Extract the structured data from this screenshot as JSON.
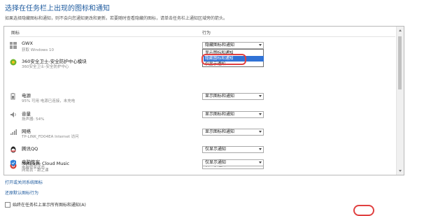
{
  "page": {
    "title": "选择在任务栏上出现的图标和通知",
    "description": "如果选择隐藏图标和通知，则不会向您通知更改和更新。若要随时查看隐藏的图标，请单击任务栏上通知区域旁的箭头。"
  },
  "table": {
    "col_icon": "图标",
    "col_behavior": "行为",
    "rows": [
      {
        "name": "GWX",
        "sub": "获取 Windows 10",
        "behavior": "隐藏图标和通知",
        "icon": "windows-logo-icon"
      },
      {
        "name": "360安全卫士-安全防护中心模块",
        "sub": "360安全卫士-安全防护中心",
        "behavior": "",
        "icon": "360-shield-icon"
      },
      {
        "name": "电源",
        "sub": "95% 可用 电源已连接，未充电",
        "behavior": "显示图标和通知",
        "icon": "power-icon"
      },
      {
        "name": "音量",
        "sub": "扬声器: 54%",
        "behavior": "显示图标和通知",
        "icon": "volume-icon"
      },
      {
        "name": "网络",
        "sub": "TP-LINK_FD04EA Internet 访问",
        "behavior": "显示图标和通知",
        "icon": "network-icon"
      },
      {
        "name": "腾讯QQ",
        "sub": "",
        "behavior": "仅显示通知",
        "icon": "qq-icon"
      },
      {
        "name": "NetEase Cloud Music",
        "sub": "网易云 - 跟之课",
        "behavior": "仅显示通知",
        "icon": "netease-music-icon"
      },
      {
        "name": "电脑管家",
        "sub": "电脑管家状态",
        "behavior": "仅显示通知",
        "icon": "pc-manager-icon"
      }
    ],
    "dropdown_options": [
      "显示图标和通知",
      "隐藏图标和通知",
      "仅显示通知"
    ],
    "dropdown_selected": 1
  },
  "links": {
    "system_icons": "打开或关闭系统图标",
    "restore_defaults": "还原默认图标行为"
  },
  "checkbox": {
    "label": "始终在任务栏上显示所有图标和通知(A)",
    "checked": false
  },
  "colors": {
    "title": "#1d5a9e",
    "selection": "#3072d6",
    "annotation": "#e04040"
  }
}
